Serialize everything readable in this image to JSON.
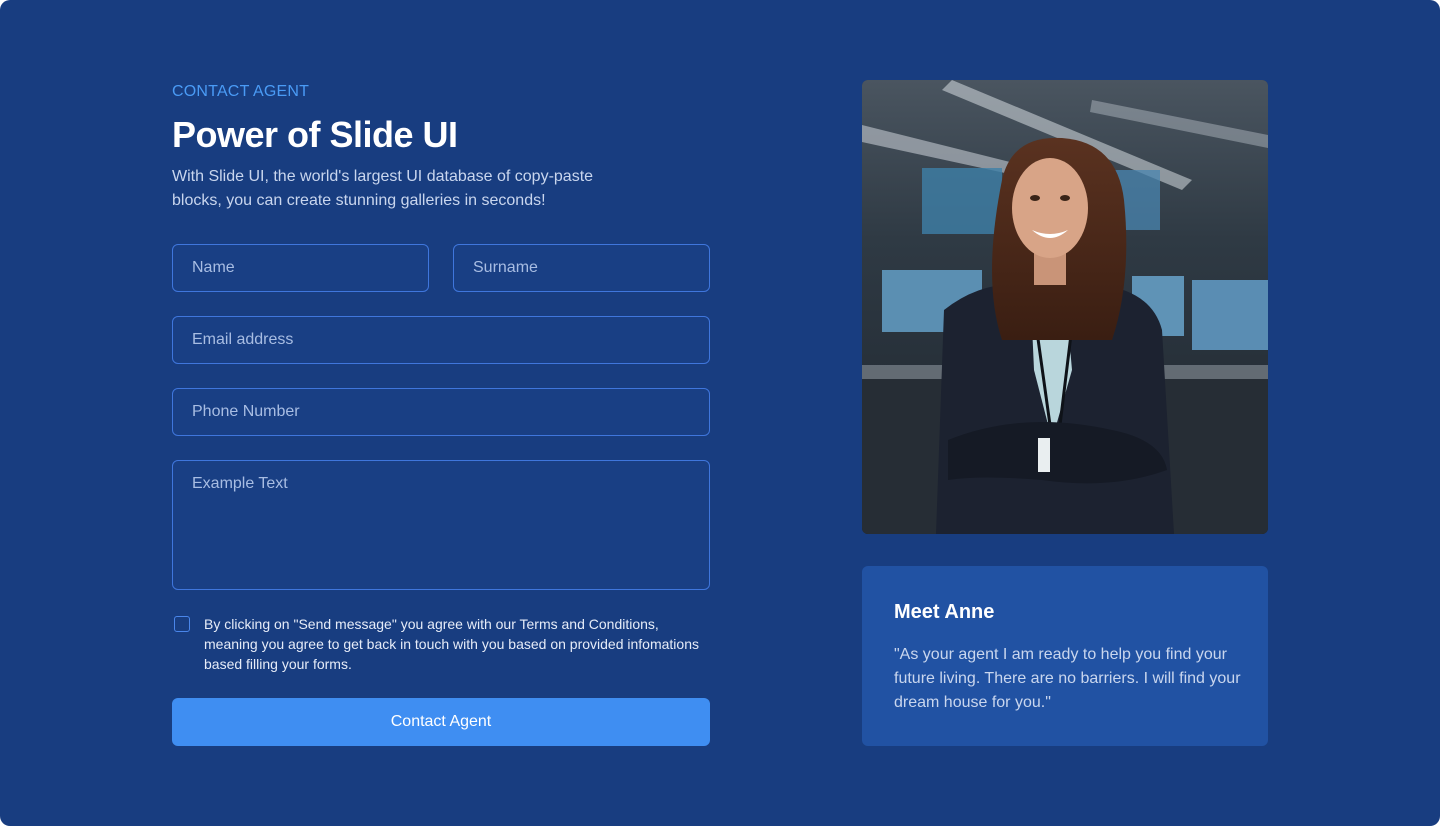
{
  "header": {
    "eyebrow": "CONTACT AGENT",
    "title": "Power of Slide UI",
    "description": "With Slide UI, the world's largest UI database of copy-paste blocks, you can create stunning galleries in seconds!"
  },
  "form": {
    "name_placeholder": "Name",
    "surname_placeholder": "Surname",
    "email_placeholder": "Email address",
    "phone_placeholder": "Phone Number",
    "message_placeholder": "Example Text",
    "terms_text": "By clicking on \"Send message\" you agree with our Terms and Conditions, meaning you agree to get back in touch with you based on provided infomations based filling your forms.",
    "terms_checked": false,
    "submit_label": "Contact Agent"
  },
  "agent": {
    "title": "Meet Anne",
    "quote": "\"As your agent I am ready to help you find your future living. There are no barriers. I will find your dream house for you.\""
  },
  "colors": {
    "background": "#183d80",
    "accent": "#3f8ef2",
    "eyebrow": "#4a9bf5",
    "card": "#2152a3",
    "input_border": "#3f76dc"
  }
}
